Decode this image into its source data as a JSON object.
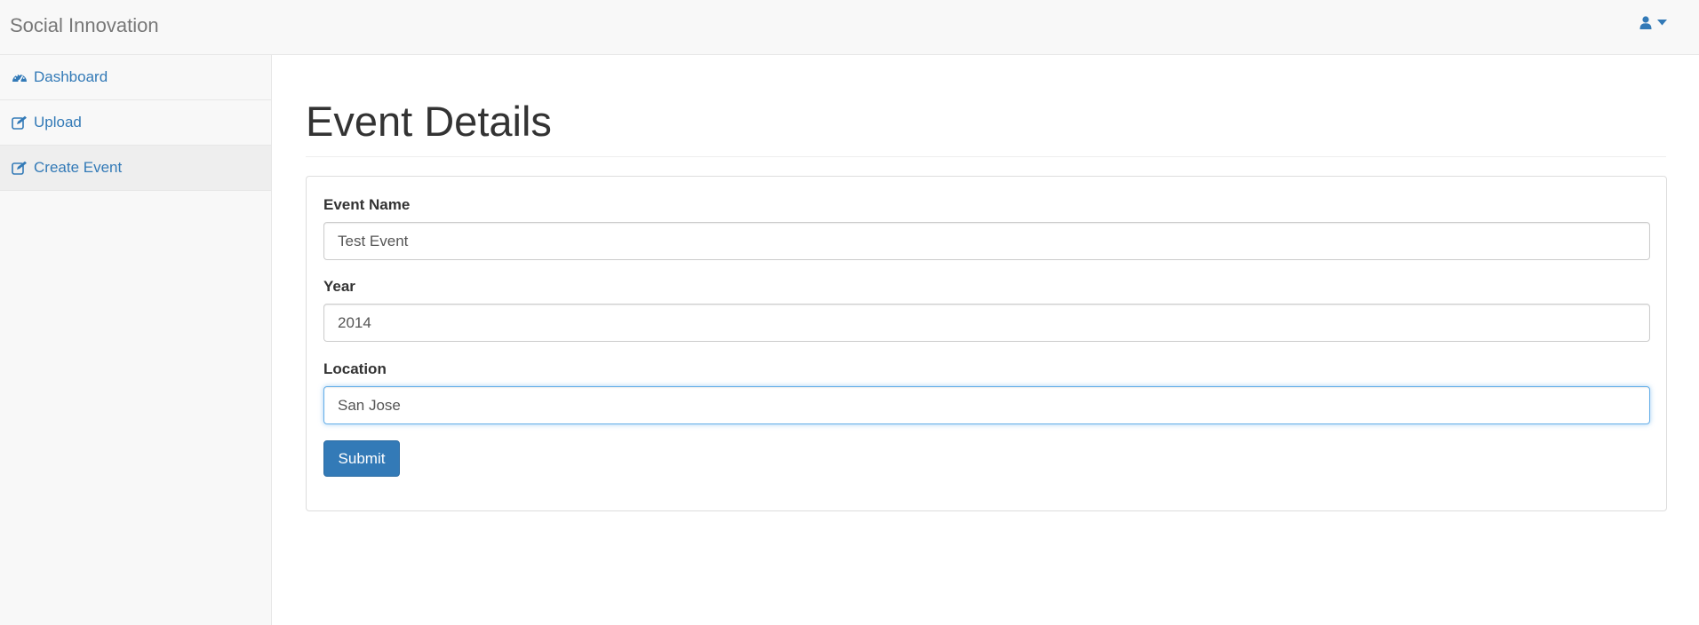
{
  "navbar": {
    "brand": "Social Innovation",
    "user_icon": "user-icon",
    "caret_icon": "caret-down-icon",
    "link_color": "#337ab7"
  },
  "sidebar": {
    "items": [
      {
        "label": "Dashboard",
        "icon": "dashboard-icon",
        "active": false
      },
      {
        "label": "Upload",
        "icon": "edit-icon",
        "active": false
      },
      {
        "label": "Create Event",
        "icon": "edit-icon",
        "active": true
      }
    ]
  },
  "main": {
    "title": "Event Details",
    "form": {
      "event_name": {
        "label": "Event Name",
        "value": "Test Event"
      },
      "year": {
        "label": "Year",
        "value": "2014"
      },
      "location": {
        "label": "Location",
        "value": "San Jose",
        "focused": true
      },
      "submit_label": "Submit"
    }
  }
}
